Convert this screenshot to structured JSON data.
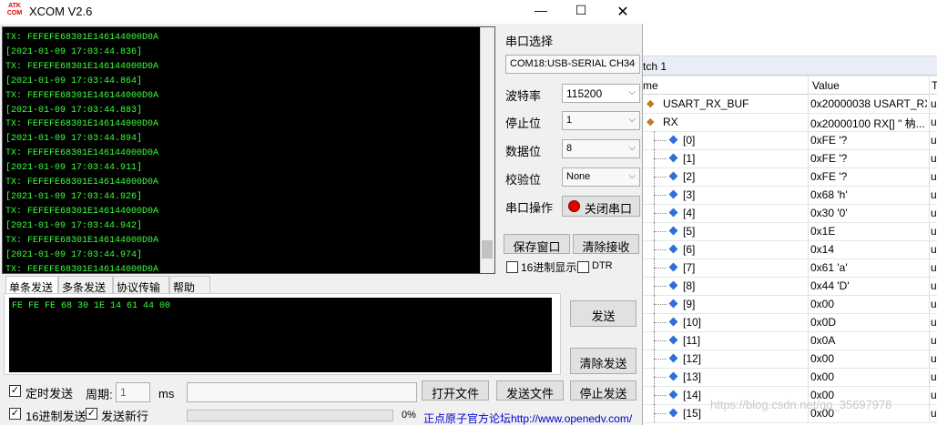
{
  "xcom": {
    "title": "XCOM V2.6",
    "logo_text": "ATK COM",
    "receive_lines": [
      {
        "k": "tx",
        "text": "TX: FEFEFE68301E146144000D0A"
      },
      {
        "k": "ts",
        "text": "[2021-01-09 17:03:44.836]"
      },
      {
        "k": "tx",
        "text": "TX: FEFEFE68301E146144000D0A"
      },
      {
        "k": "ts",
        "text": "[2021-01-09 17:03:44.864]"
      },
      {
        "k": "tx",
        "text": "TX: FEFEFE68301E146144000D0A"
      },
      {
        "k": "ts",
        "text": "[2021-01-09 17:03:44.883]"
      },
      {
        "k": "tx",
        "text": "TX: FEFEFE68301E146144000D0A"
      },
      {
        "k": "ts",
        "text": "[2021-01-09 17:03:44.894]"
      },
      {
        "k": "tx",
        "text": "TX: FEFEFE68301E146144000D0A"
      },
      {
        "k": "ts",
        "text": "[2021-01-09 17:03:44.911]"
      },
      {
        "k": "tx",
        "text": "TX: FEFEFE68301E146144000D0A"
      },
      {
        "k": "ts",
        "text": "[2021-01-09 17:03:44.926]"
      },
      {
        "k": "tx",
        "text": "TX: FEFEFE68301E146144000D0A"
      },
      {
        "k": "ts",
        "text": "[2021-01-09 17:03:44.942]"
      },
      {
        "k": "tx",
        "text": "TX: FEFEFE68301E146144000D0A"
      },
      {
        "k": "ts",
        "text": "[2021-01-09 17:03:44.974]"
      },
      {
        "k": "tx",
        "text": "TX: FEFEFE68301E146144000D0A"
      }
    ],
    "settings": {
      "port_label": "串口选择",
      "port_value": "COM18:USB-SERIAL CH34",
      "baud_label": "波特率",
      "baud_value": "115200",
      "stop_label": "停止位",
      "stop_value": "1",
      "data_label": "数据位",
      "data_value": "8",
      "parity_label": "校验位",
      "parity_value": "None",
      "op_label": "串口操作",
      "close_port_label": "关闭串口",
      "save_window_label": "保存窗口",
      "clear_recv_label": "清除接收",
      "hex_display_label": "16进制显示",
      "dtr_label": "DTR"
    },
    "tabs": [
      "单条发送",
      "多条发送",
      "协议传输",
      "帮助"
    ],
    "send_text": "FE FE FE 68 30 1E 14 61 44 00",
    "send_label": "发送",
    "clear_send_label": "清除发送",
    "timed_send_label": "定时发送",
    "period_label": "周期:",
    "period_value": "1",
    "ms_label": "ms",
    "open_file_label": "打开文件",
    "send_file_label": "发送文件",
    "stop_send_label": "停止发送",
    "hex_send_label": "16进制发送",
    "send_newline_label": "发送新行",
    "progress_text": "0%",
    "progress_fraction": 0,
    "forum_link": "正点原子官方论坛http://www.openedv.com/"
  },
  "watch": {
    "tab_title": "tch 1",
    "col_name": "me",
    "col_value": "Value",
    "col_type": "T",
    "rows": [
      {
        "name": "USART_RX_BUF",
        "value": "0x20000038 USART_RX...",
        "type": "u"
      },
      {
        "name": "RX",
        "value": "0x20000100 RX[] \"   枘...",
        "type": "u"
      },
      {
        "name": "[0]",
        "value": "0xFE '?",
        "type": "u"
      },
      {
        "name": "[1]",
        "value": "0xFE '?",
        "type": "u"
      },
      {
        "name": "[2]",
        "value": "0xFE '?",
        "type": "u"
      },
      {
        "name": "[3]",
        "value": "0x68 'h'",
        "type": "u"
      },
      {
        "name": "[4]",
        "value": "0x30 '0'",
        "type": "u"
      },
      {
        "name": "[5]",
        "value": "0x1E",
        "type": "u"
      },
      {
        "name": "[6]",
        "value": "0x14",
        "type": "u"
      },
      {
        "name": "[7]",
        "value": "0x61 'a'",
        "type": "u"
      },
      {
        "name": "[8]",
        "value": "0x44 'D'",
        "type": "u"
      },
      {
        "name": "[9]",
        "value": "0x00",
        "type": "u"
      },
      {
        "name": "[10]",
        "value": "0x0D",
        "type": "u"
      },
      {
        "name": "[11]",
        "value": "0x0A",
        "type": "u"
      },
      {
        "name": "[12]",
        "value": "0x00",
        "type": "u"
      },
      {
        "name": "[13]",
        "value": "0x00",
        "type": "u"
      },
      {
        "name": "[14]",
        "value": "0x00",
        "type": "u"
      },
      {
        "name": "[15]",
        "value": "0x00",
        "type": "u"
      }
    ],
    "watermark": "https://blog.csdn.net/qq_35697978"
  }
}
